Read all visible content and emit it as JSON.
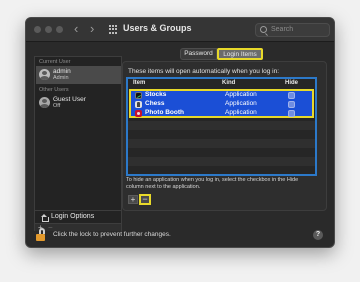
{
  "window": {
    "title": "Users & Groups"
  },
  "search": {
    "placeholder": "Search"
  },
  "sidebar": {
    "current_user_label": "Current User",
    "current_user": {
      "name": "admin",
      "role": "Admin"
    },
    "other_users_label": "Other Users",
    "other_users": [
      {
        "name": "Guest User",
        "role": "Off"
      }
    ],
    "login_options_label": "Login Options",
    "add_symbol": "+",
    "remove_symbol": "−"
  },
  "tabs": [
    {
      "label": "Password",
      "selected": false
    },
    {
      "label": "Login Items",
      "selected": true
    }
  ],
  "login_items": {
    "intro": "These items will open automatically when you log in:",
    "columns": {
      "item": "Item",
      "kind": "Kind",
      "hide": "Hide"
    },
    "rows": [
      {
        "name": "Stocks",
        "icon": "stocks-app-icon",
        "kind": "Application",
        "hide": false
      },
      {
        "name": "Chess",
        "icon": "chess-app-icon",
        "kind": "Application",
        "hide": false
      },
      {
        "name": "Photo Booth",
        "icon": "photo-booth-app-icon",
        "kind": "Application",
        "hide": false
      }
    ],
    "help_text": "To hide an application when you log in, select the checkbox in the Hide column next to the application.",
    "add_symbol": "+",
    "remove_symbol": "−"
  },
  "footer": {
    "lock_text": "Click the lock to prevent further changes.",
    "help_symbol": "?"
  },
  "colors": {
    "selection": "#1b4fd6",
    "highlight_annotation": "#e8d92a",
    "list_focus_ring": "#2c79c9",
    "lock": "#e39a2d"
  }
}
